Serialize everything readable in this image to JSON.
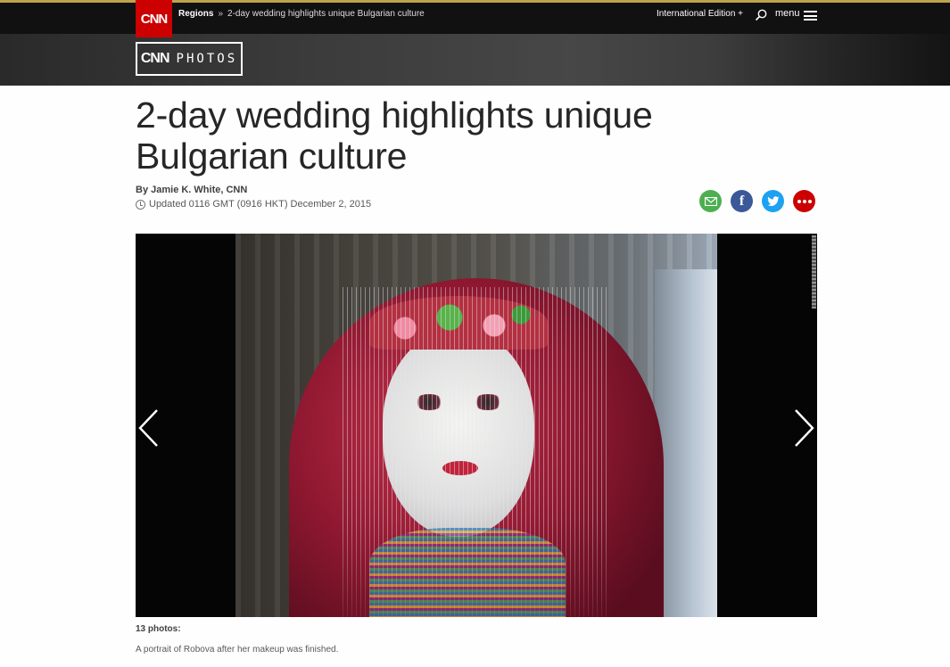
{
  "header": {
    "logo_text": "CNN",
    "breadcrumb": {
      "section": "Regions",
      "separator": "»",
      "current": "2-day wedding highlights unique Bulgarian culture"
    },
    "edition": "International Edition +",
    "search_icon": "search-icon",
    "menu_label": "menu",
    "menu_icon": "hamburger-menu-icon",
    "section_logo": {
      "brand": "CNN",
      "word": "PHOTOS"
    }
  },
  "article": {
    "headline": "2-day wedding highlights unique Bulgarian culture",
    "byline": "By Jamie K. White, CNN",
    "updated": "Updated 0116 GMT (0916 HKT) December 2, 2015"
  },
  "share": [
    {
      "name": "email",
      "icon": "email-icon",
      "color": "#4caf50"
    },
    {
      "name": "facebook",
      "icon": "facebook-icon",
      "color": "#3b5998"
    },
    {
      "name": "twitter",
      "icon": "twitter-icon",
      "color": "#1da1f2"
    },
    {
      "name": "more",
      "icon": "more-icon",
      "color": "#cc0000"
    }
  ],
  "gallery": {
    "count_label": "13 photos:",
    "caption": "A portrait of Robova after her makeup was finished.",
    "prev_icon": "chevron-left-icon",
    "next_icon": "chevron-right-icon"
  },
  "colors": {
    "brand_red": "#cc0000",
    "masthead": "#111111",
    "text": "#262626"
  }
}
